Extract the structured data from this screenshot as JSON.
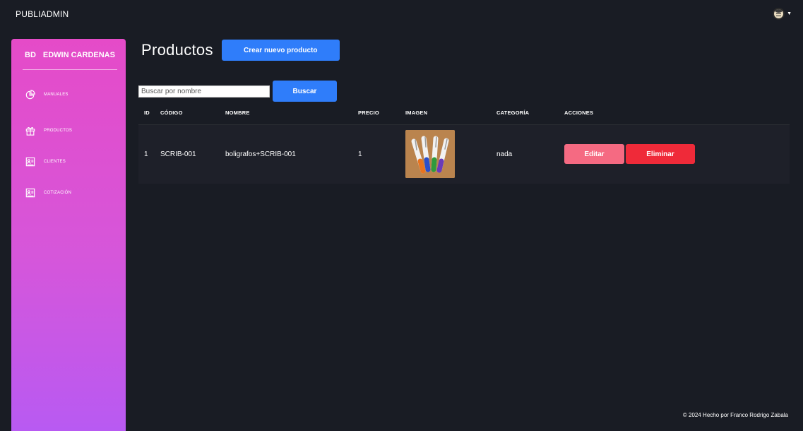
{
  "navbar": {
    "brand": "PUBLIADMIN",
    "user_icon": "user-avatar-icon",
    "menu_icon": "caret-down-icon"
  },
  "sidebar": {
    "user_initials": "BD",
    "user_name": "EDWIN CARDENAS",
    "items": [
      {
        "label": "MANUALES",
        "icon": "pie-chart-icon"
      },
      {
        "label": "PRODUCTOS",
        "icon": "gift-icon"
      },
      {
        "label": "CLIENTES",
        "icon": "id-card-icon"
      },
      {
        "label": "COTIZACIÓN",
        "icon": "id-card-icon"
      }
    ]
  },
  "page": {
    "title": "Productos",
    "create_button": "Crear nuevo producto"
  },
  "search": {
    "placeholder": "Buscar por nombre",
    "value": "",
    "button": "Buscar"
  },
  "table": {
    "columns": [
      "ID",
      "CÓDIGO",
      "NOMBRE",
      "PRECIO",
      "IMAGEN",
      "CATEGORÍA",
      "ACCIONES"
    ],
    "rows": [
      {
        "id": "1",
        "code": "SCRIB-001",
        "name": "boligrafos+SCRIB-001",
        "price": "1",
        "image": "pens-photo",
        "category": "nada",
        "edit": "Editar",
        "delete": "Eliminar"
      }
    ]
  },
  "footer": {
    "text": "© 2024 Hecho por Franco Rodrigo Zabala"
  },
  "colors": {
    "background": "#191c24",
    "primary": "#2f7dfa",
    "edit": "#f56a82",
    "delete": "#ef2a39",
    "sidebar_top": "#e54bc8",
    "sidebar_bottom": "#b85af2"
  }
}
